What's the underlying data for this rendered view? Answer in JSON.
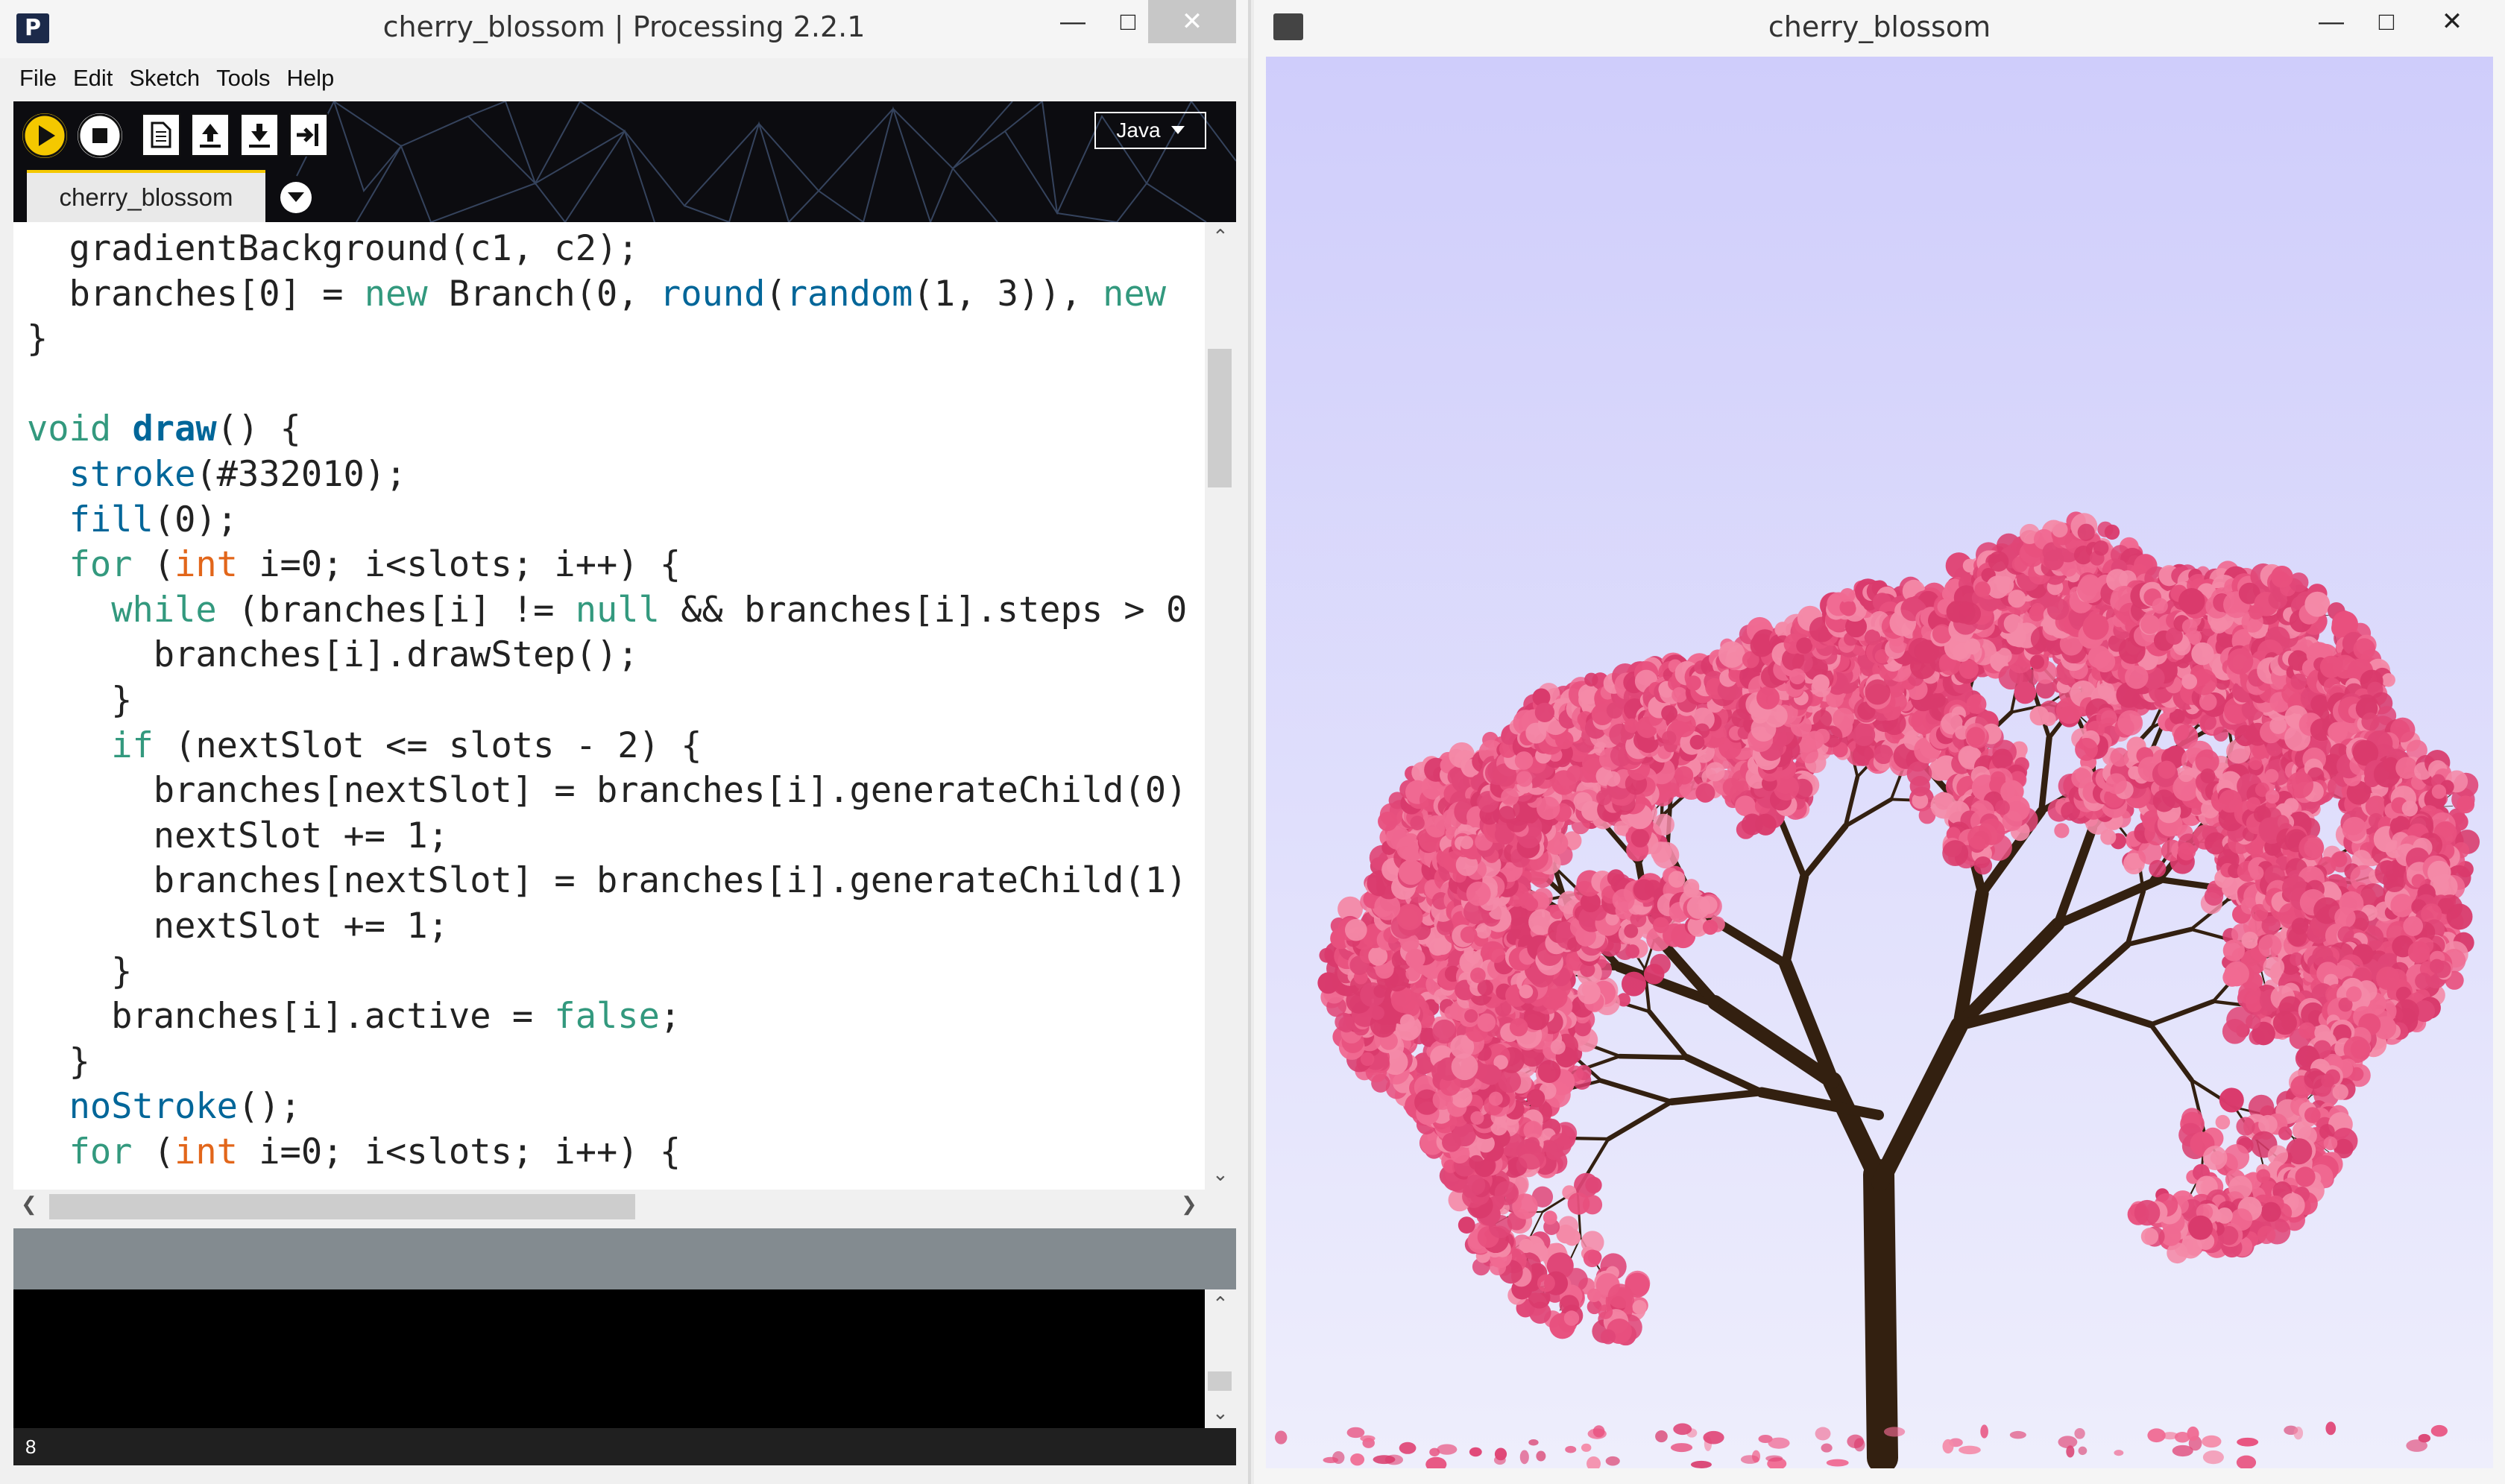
{
  "ide": {
    "window_title": "cherry_blossom | Processing 2.2.1",
    "app_icon_letter": "P",
    "menu": [
      "File",
      "Edit",
      "Sketch",
      "Tools",
      "Help"
    ],
    "toolbar": {
      "run_icon": "play-icon",
      "stop_icon": "stop-icon",
      "new_icon": "new-file-icon",
      "open_icon": "open-icon",
      "save_icon": "save-icon",
      "export_icon": "export-icon"
    },
    "mode": "Java",
    "tab_label": "cherry_blossom",
    "status_line_number": "8",
    "colors": {
      "accent_yellow": "#f4c800",
      "keyword_green": "#33997e",
      "keyword_blue": "#006699",
      "keyword_orange": "#e2661a",
      "console_bg": "#000000",
      "status_bg": "#838b90"
    }
  },
  "code_lines": [
    "  gradientBackground(c1, c2);",
    "  branches[0] = new Branch(0, round(random(1, 3)), new",
    "}",
    "",
    "void draw() {",
    "  stroke(#332010);",
    "  fill(0);",
    "  for (int i=0; i<slots; i++) {",
    "    while (branches[i] != null && branches[i].steps > 0",
    "      branches[i].drawStep();",
    "    }",
    "    if (nextSlot <= slots - 2) {",
    "      branches[nextSlot] = branches[i].generateChild(0)",
    "      nextSlot += 1;",
    "      branches[nextSlot] = branches[i].generateChild(1)",
    "      nextSlot += 1;",
    "    }",
    "    branches[i].active = false;",
    "  }",
    "  noStroke();",
    "  for (int i=0; i<slots; i++) {"
  ],
  "sketch": {
    "window_title": "cherry_blossom",
    "colors": {
      "sky_top": "#cfcdfb",
      "sky_bottom": "#eeeefc",
      "trunk": "#332010",
      "blossom": "#e8507e",
      "blossom_light": "#f48aa8"
    }
  }
}
